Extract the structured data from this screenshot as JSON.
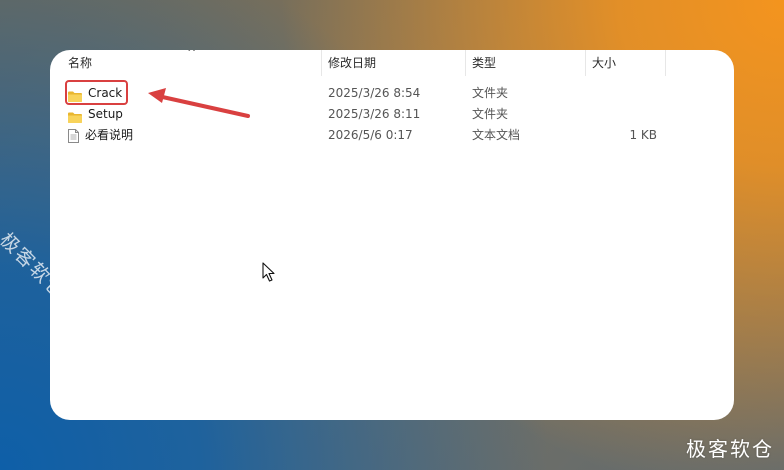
{
  "columns": {
    "name": "名称",
    "date": "修改日期",
    "type": "类型",
    "size": "大小"
  },
  "sort_indicator": "^",
  "files": [
    {
      "name": "Crack",
      "date": "2025/3/26 8:54",
      "type": "文件夹",
      "size": "",
      "icon": "folder-icon"
    },
    {
      "name": "Setup",
      "date": "2025/3/26 8:11",
      "type": "文件夹",
      "size": "",
      "icon": "folder-icon"
    },
    {
      "name": "必看说明",
      "date": "2026/5/6 0:17",
      "type": "文本文档",
      "size": "1 KB",
      "icon": "text-document-icon"
    }
  ],
  "annotation": {
    "highlight_color": "#d94040",
    "highlighted_item": "Crack"
  },
  "watermark": {
    "diagonal": "极客软仓",
    "corner": "极客软仓"
  },
  "colors": {
    "folder": "#f5c542",
    "window_bg": "#ffffff",
    "accent_orange": "#f4941e",
    "accent_blue": "#0e5fa8"
  }
}
